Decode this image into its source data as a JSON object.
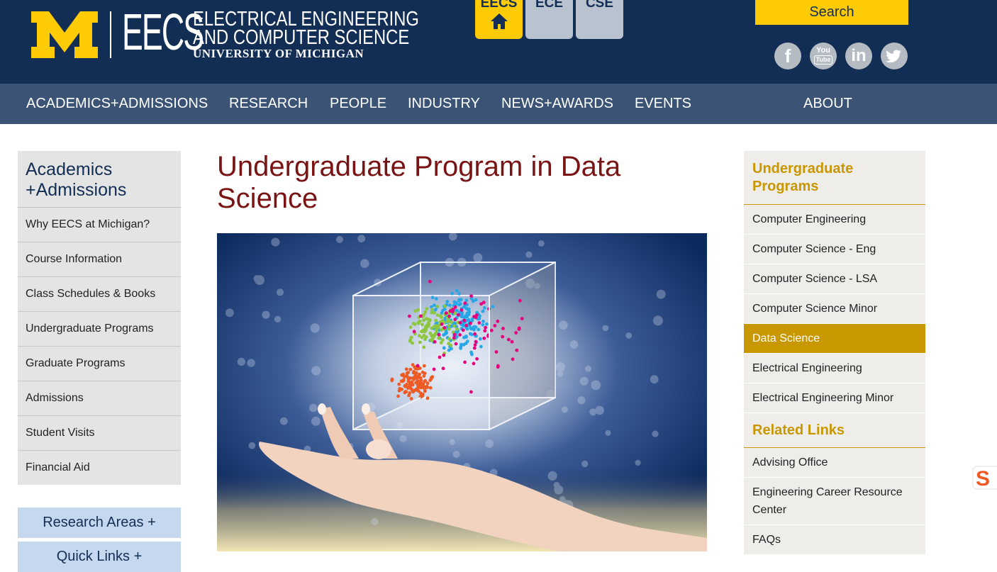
{
  "header": {
    "logo": {
      "wordmark": "EECS",
      "line1": "ELECTRICAL ENGINEERING",
      "line2": "AND COMPUTER SCIENCE",
      "line3": "UNIVERSITY OF MICHIGAN"
    },
    "dept_tabs": [
      "EECS",
      "ECE",
      "CSE"
    ],
    "search_label": "Search",
    "social": [
      {
        "name": "facebook-icon",
        "glyph": "f"
      },
      {
        "name": "youtube-icon",
        "glyph": "You Tube"
      },
      {
        "name": "linkedin-icon",
        "glyph": "in"
      },
      {
        "name": "twitter-icon",
        "glyph": "bird"
      }
    ]
  },
  "nav": {
    "items": [
      "ACADEMICS+ADMISSIONS",
      "RESEARCH",
      "PEOPLE",
      "INDUSTRY",
      "NEWS+AWARDS",
      "EVENTS",
      "ABOUT"
    ]
  },
  "left_sidebar": {
    "title": "Academics +Admissions",
    "items": [
      "Why EECS at Michigan?",
      "Course Information",
      "Class Schedules & Books",
      "Undergraduate Programs",
      "Graduate Programs",
      "Admissions",
      "Student Visits",
      "Financial Aid"
    ],
    "research_button": "Research Areas +",
    "quick_links_button": "Quick Links +"
  },
  "main": {
    "title": "Undergraduate Program in Data Science"
  },
  "right_sidebar": {
    "programs_title": "Undergraduate Programs",
    "programs": [
      "Computer Engineering",
      "Computer Science - Eng",
      "Computer Science - LSA",
      "Computer Science Minor",
      "Data Science",
      "Electrical Engineering",
      "Electrical Engineering Minor"
    ],
    "active_program": "Data Science",
    "related_title": "Related Links",
    "related": [
      "Advising Office",
      "Engineering Career Resource Center",
      "FAQs"
    ]
  },
  "colors": {
    "header_bg": "#132e54",
    "nav_bg": "#3b5475",
    "maize": "#ffcb05",
    "gold": "#c99700",
    "title_red": "#7a1414"
  }
}
